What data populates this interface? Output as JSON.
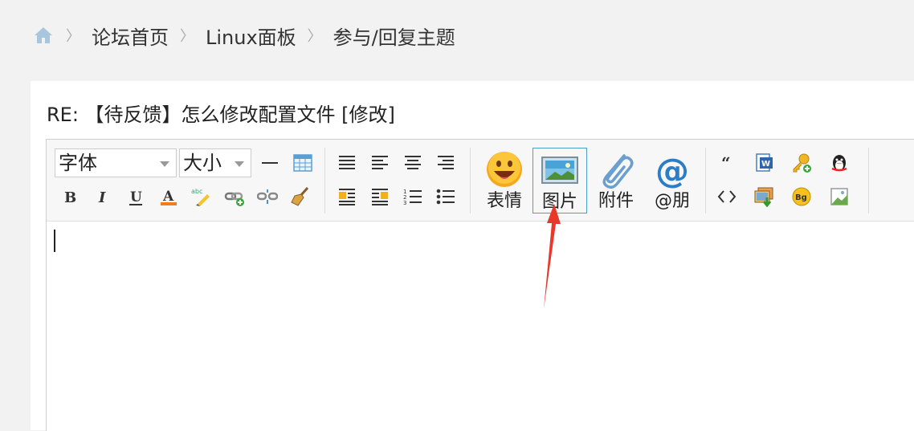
{
  "breadcrumb": {
    "home_icon": "home-icon",
    "items": [
      "论坛首页",
      "Linux面板",
      "参与/回复主题"
    ],
    "separator": "〉"
  },
  "post": {
    "title": "RE: 【待反馈】怎么修改配置文件 [修改]"
  },
  "toolbar": {
    "font_select": "字体",
    "size_select": "大小",
    "big_buttons": {
      "emoji": "表情",
      "image": "图片",
      "attachment": "附件",
      "mention": "@朋"
    },
    "colors": {
      "active_border": "#4aa0c8",
      "annotation_arrow": "#e8372c"
    }
  }
}
